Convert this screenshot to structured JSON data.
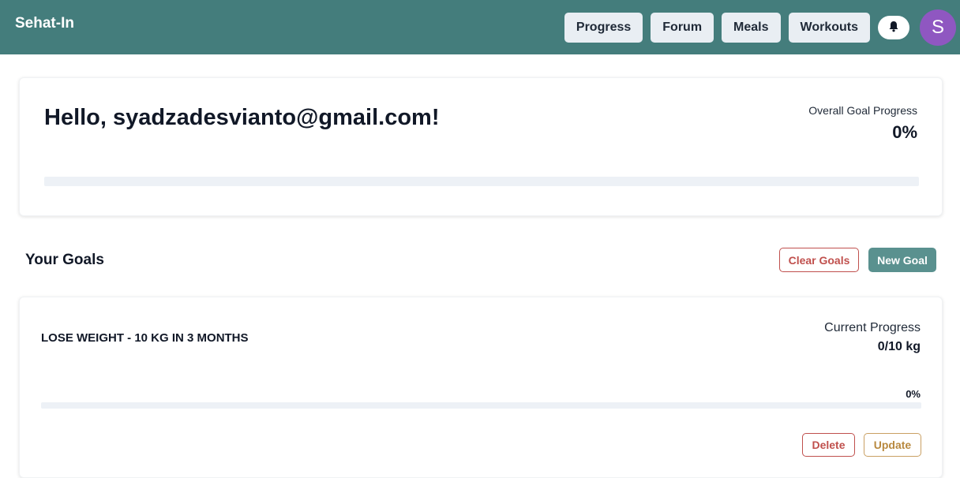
{
  "header": {
    "brand": "Sehat-In",
    "nav": [
      {
        "label": "Progress"
      },
      {
        "label": "Forum"
      },
      {
        "label": "Meals"
      },
      {
        "label": "Workouts"
      }
    ],
    "notifications_icon": "bell-icon",
    "avatar_letter": "S"
  },
  "greeting": {
    "text": "Hello, syadzadesvianto@gmail.com!",
    "overall_label": "Overall Goal Progress",
    "overall_value": "0%",
    "overall_fraction": 0
  },
  "goals_section": {
    "title": "Your Goals",
    "clear_label": "Clear Goals",
    "new_label": "New Goal"
  },
  "goals": [
    {
      "title": "LOSE WEIGHT - 10 KG IN 3 MONTHS",
      "progress_label": "Current Progress",
      "progress_value": "0/10 kg",
      "percent_text": "0%",
      "fraction": 0,
      "delete_label": "Delete",
      "update_label": "Update"
    }
  ],
  "colors": {
    "header_bg": "#447d7c",
    "accent_teal": "#5a918f",
    "danger": "#c0504d",
    "warning": "#b8893f",
    "avatar_bg": "#8f57c1"
  }
}
